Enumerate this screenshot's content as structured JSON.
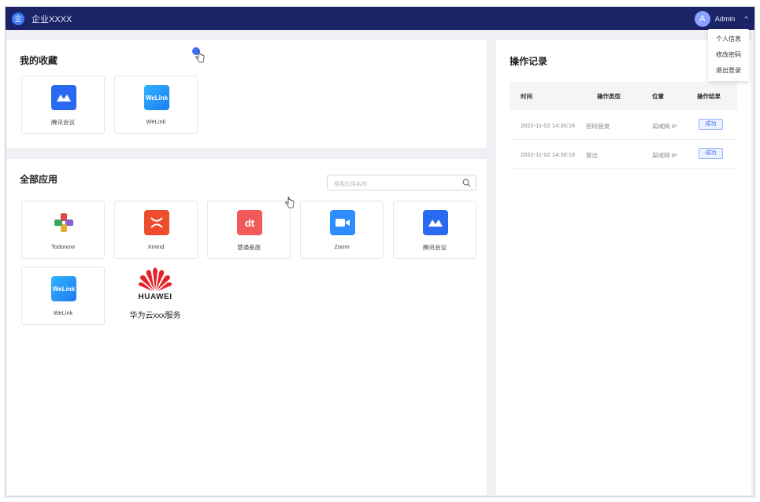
{
  "header": {
    "logo_glyph": "企",
    "brand": "企业XXXX",
    "avatar_letter": "A",
    "username": "Admin",
    "caret": "^"
  },
  "user_menu": {
    "items": [
      "个人信息",
      "修改密码",
      "退出登录"
    ]
  },
  "favorites": {
    "title": "我的收藏",
    "items": [
      {
        "label": "腾讯会议",
        "icon": "tencent-meeting-icon"
      },
      {
        "label": "WeLink",
        "icon": "welink-icon",
        "icon_text": "WeLink"
      }
    ]
  },
  "all_apps": {
    "title": "全部应用",
    "search_placeholder": "搜索应用名称",
    "items": [
      {
        "label": "Todonow",
        "icon": "todonow-icon"
      },
      {
        "label": "Xmind",
        "icon": "xmind-icon"
      },
      {
        "label": "慧通差旅",
        "icon": "huitong-icon",
        "icon_text": "dt"
      },
      {
        "label": "Zoom",
        "icon": "zoom-icon"
      },
      {
        "label": "腾讯会议",
        "icon": "tencent-meeting-icon"
      },
      {
        "label": "WeLink",
        "icon": "welink-icon",
        "icon_text": "WeLink"
      }
    ],
    "huawei": {
      "logo_text": "HUAWEI",
      "label": "华为云xxx服务"
    }
  },
  "operation_log": {
    "title": "操作记录",
    "columns": [
      "时间",
      "操作类型",
      "位置",
      "操作结果"
    ],
    "rows": [
      {
        "time": "2022-11-02  14:30:16",
        "type": "密码登录",
        "location": "局域网 IP",
        "result": "成功"
      },
      {
        "time": "2022-11-02  14:30:16",
        "type": "登出",
        "location": "局域网 IP",
        "result": "成功"
      }
    ]
  },
  "colors": {
    "topbar": "#1b2467",
    "accent": "#3f6cf6",
    "success_tag_bg": "#eaf1ff"
  }
}
